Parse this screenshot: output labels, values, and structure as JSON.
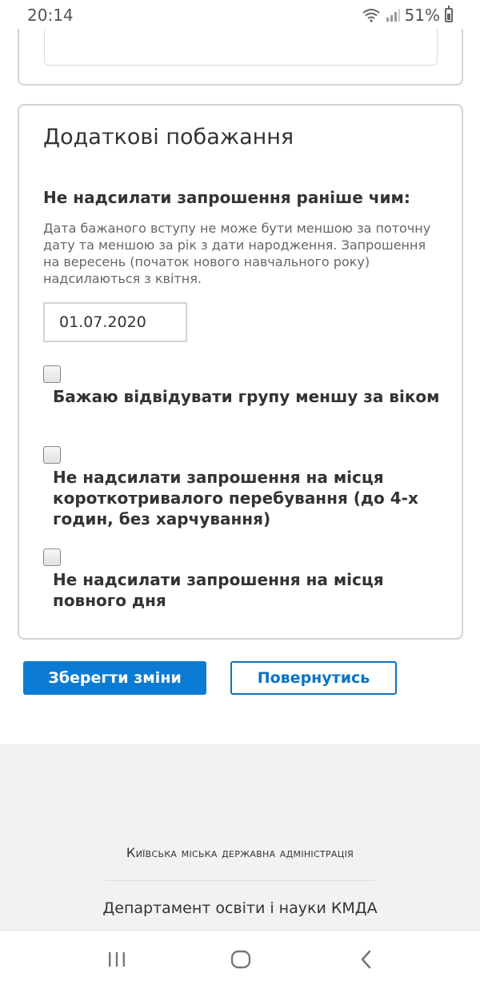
{
  "status": {
    "time": "20:14",
    "battery": "51%"
  },
  "card": {
    "title": "Додаткові побажання",
    "field_label": "Не надсилати запрошення раніше чим:",
    "help_text": "Дата бажаного вступу не може бути меншою за поточну дату та меншою за рік з дати народження. Запрошення на вересень (початок нового навчального року) надсилаються з квітня.",
    "date_value": "01.07.2020",
    "checkboxes": [
      {
        "label": "Бажаю відвідувати групу меншу за віком",
        "checked": false
      },
      {
        "label": "Не надсилати запрошення на місця короткотривалого перебування (до 4-х годин, без харчування)",
        "checked": false
      },
      {
        "label": "Не надсилати запрошення на місця повного дня",
        "checked": false
      }
    ]
  },
  "buttons": {
    "save": "Зберегти зміни",
    "back": "Повернутись"
  },
  "footer": {
    "org": "Київська міська державна адміністрація",
    "dept": "Департамент освіти і науки КМДА"
  },
  "colors": {
    "primary": "#0b7bd3",
    "border": "#d3d3d3",
    "footer_bg": "#f1f2f3"
  }
}
